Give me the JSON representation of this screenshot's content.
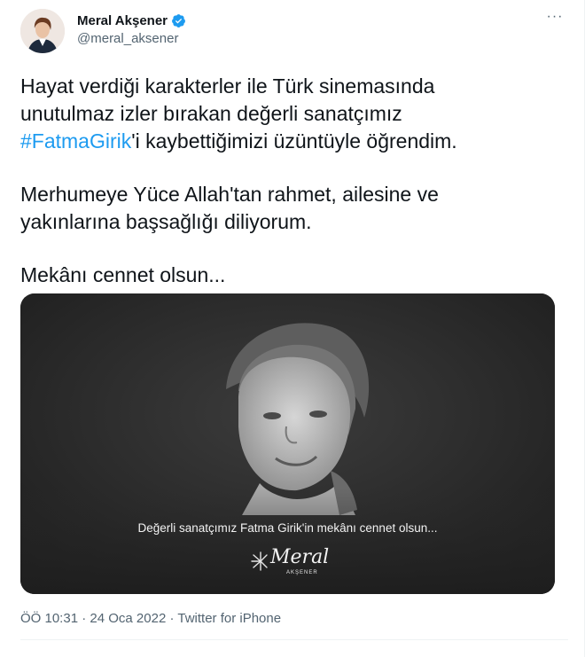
{
  "author": {
    "display_name": "Meral Akşener",
    "handle": "@meral_aksener",
    "verified": true
  },
  "more_label": "···",
  "tweet": {
    "line1": "Hayat verdiği karakterler ile Türk sinemasında",
    "line2": "unutulmaz izler bırakan değerli sanatçımız",
    "hashtag": "#FatmaGirik",
    "line3_rest": "'i kaybettiğimizi üzüntüyle öğrendim.",
    "paragraph2_line1": "Merhumeye Yüce Allah'tan rahmet, ailesine ve",
    "paragraph2_line2": "yakınlarına başsağlığı diliyorum.",
    "paragraph3": "Mekânı cennet olsun..."
  },
  "media": {
    "caption": "Değerli sanatçımız Fatma Girik'in mekânı cennet olsun...",
    "logo_main": "Meral",
    "logo_sub": "AKŞENER"
  },
  "meta": {
    "time": "ÖÖ 10:31",
    "separator": " · ",
    "date": "24 Oca 2022",
    "source": "Twitter for iPhone"
  },
  "colors": {
    "link": "#1d9bf0",
    "verified": "#1d9bf0",
    "secondary_text": "#536471"
  }
}
